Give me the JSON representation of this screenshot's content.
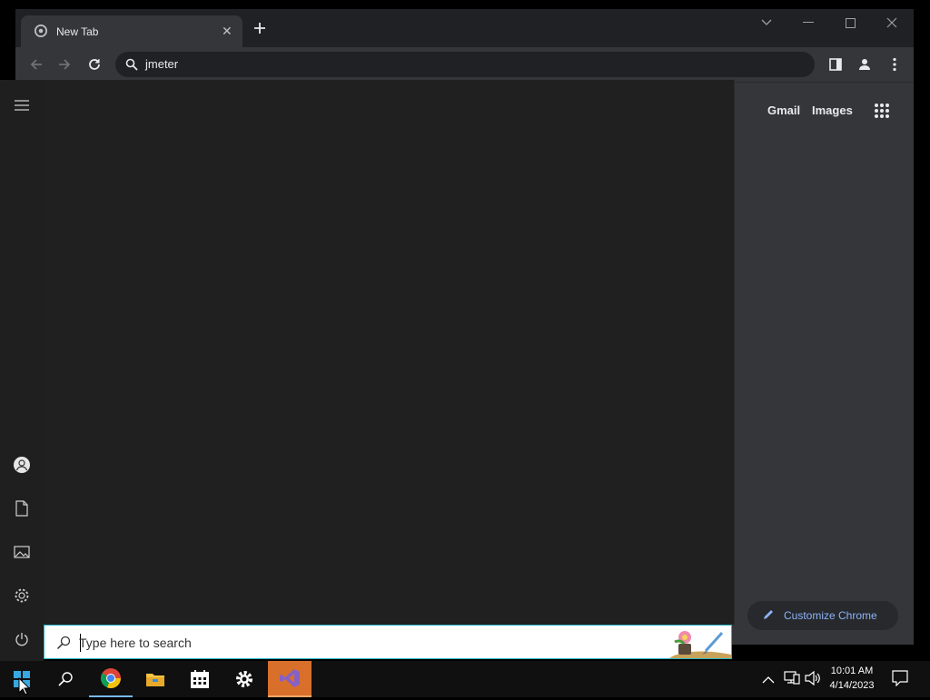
{
  "browser": {
    "tab_title": "New Tab",
    "address": "jmeter",
    "links": {
      "gmail": "Gmail",
      "images": "Images"
    },
    "customize_label": "Customize Chrome"
  },
  "start_menu": {
    "search_placeholder": "Type here to search"
  },
  "taskbar": {
    "time": "10:01 AM",
    "date": "4/14/2023",
    "pinned": [
      "chrome-icon",
      "file-explorer-icon",
      "calendar-icon",
      "settings-icon",
      "visual-studio-icon"
    ]
  },
  "colors": {
    "accent_search_border": "#2ab3c6",
    "link_blue": "#8ab4f8",
    "chrome_frame": "#202124",
    "chrome_surface": "#35363a"
  }
}
